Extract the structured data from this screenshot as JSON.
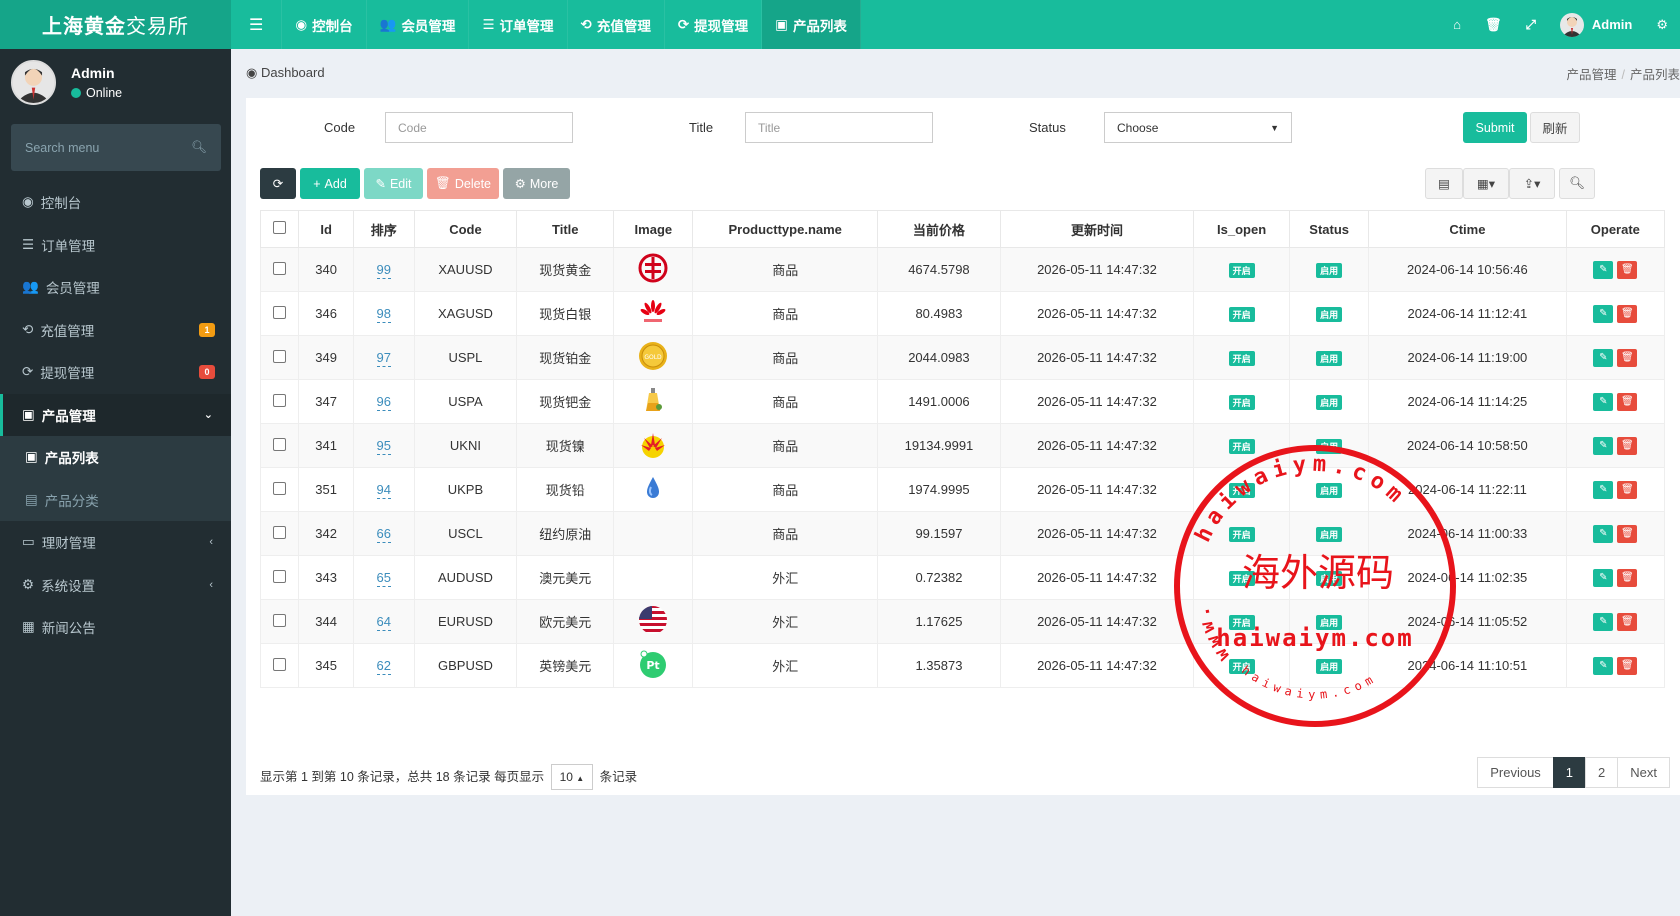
{
  "app": {
    "title_bold": "上海黄金",
    "title_rest": "交易所"
  },
  "topnav": [
    {
      "label": "控制台",
      "icon": "dashboard-icon"
    },
    {
      "label": "会员管理",
      "icon": "users-icon"
    },
    {
      "label": "订单管理",
      "icon": "list-icon"
    },
    {
      "label": "充值管理",
      "icon": "deposit-icon"
    },
    {
      "label": "提现管理",
      "icon": "withdraw-icon"
    },
    {
      "label": "产品列表",
      "icon": "shopping-bag-icon",
      "active": true
    }
  ],
  "topright": {
    "user": "Admin"
  },
  "sidebar": {
    "user": "Admin",
    "status": "Online",
    "search_placeholder": "Search menu",
    "items": [
      {
        "label": "控制台",
        "icon": "dashboard-icon"
      },
      {
        "label": "订单管理",
        "icon": "list-icon"
      },
      {
        "label": "会员管理",
        "icon": "users-icon"
      },
      {
        "label": "充值管理",
        "icon": "deposit-icon",
        "badge": "1",
        "badge_color": "#f39c12"
      },
      {
        "label": "提现管理",
        "icon": "withdraw-icon",
        "badge": "0",
        "badge_color": "#e74c3c"
      },
      {
        "label": "产品管理",
        "icon": "shopping-bag-icon",
        "open": true
      },
      {
        "label": "产品列表",
        "sub": true,
        "current": true
      },
      {
        "label": "产品分类",
        "sub": true
      },
      {
        "label": "理财管理",
        "icon": "finance-icon",
        "collapsible": true
      },
      {
        "label": "系统设置",
        "icon": "settings-icon",
        "collapsible": true
      },
      {
        "label": "新闻公告",
        "icon": "news-icon"
      }
    ]
  },
  "breadcrumb": {
    "left": "Dashboard",
    "right": [
      "产品管理",
      "产品列表"
    ]
  },
  "filters": {
    "code_label": "Code",
    "code_placeholder": "Code",
    "title_label": "Title",
    "title_placeholder": "Title",
    "status_label": "Status",
    "status_value": "Choose",
    "submit": "Submit",
    "reset": "刷新"
  },
  "toolbar": {
    "add": "Add",
    "edit": "Edit",
    "delete": "Delete",
    "more": "More"
  },
  "columns": [
    "Id",
    "排序",
    "Code",
    "Title",
    "Image",
    "Producttype.name",
    "当前价格",
    "更新时间",
    "Is_open",
    "Status",
    "Ctime",
    "Operate"
  ],
  "rows": [
    {
      "id": "340",
      "sort": "99",
      "code": "XAUUSD",
      "title": "现货黄金",
      "image": "icbc-logo",
      "type": "商品",
      "price": "4674.5798",
      "utime": "2026-05-11 14:47:32",
      "is_open": "开启",
      "status": "启用",
      "ctime": "2024-06-14 10:56:46"
    },
    {
      "id": "346",
      "sort": "98",
      "code": "XAGUSD",
      "title": "现货白银",
      "image": "huawei-logo",
      "type": "商品",
      "price": "80.4983",
      "utime": "2026-05-11 14:47:32",
      "is_open": "开启",
      "status": "启用",
      "ctime": "2024-06-14 11:12:41"
    },
    {
      "id": "349",
      "sort": "97",
      "code": "USPL",
      "title": "现货铂金",
      "image": "gold-coin",
      "type": "商品",
      "price": "2044.0983",
      "utime": "2026-05-11 14:47:32",
      "is_open": "开启",
      "status": "启用",
      "ctime": "2024-06-14 11:19:00"
    },
    {
      "id": "347",
      "sort": "96",
      "code": "USPA",
      "title": "现货钯金",
      "image": "oil-bottle",
      "type": "商品",
      "price": "1491.0006",
      "utime": "2026-05-11 14:47:32",
      "is_open": "开启",
      "status": "启用",
      "ctime": "2024-06-14 11:14:25"
    },
    {
      "id": "341",
      "sort": "95",
      "code": "UKNI",
      "title": "现货镍",
      "image": "petrochina-logo",
      "type": "商品",
      "price": "19134.9991",
      "utime": "2026-05-11 14:47:32",
      "is_open": "开启",
      "status": "启用",
      "ctime": "2024-06-14 10:58:50"
    },
    {
      "id": "351",
      "sort": "94",
      "code": "UKPB",
      "title": "现货铅",
      "image": "water-drop",
      "type": "商品",
      "price": "1974.9995",
      "utime": "2026-05-11 14:47:32",
      "is_open": "开启",
      "status": "启用",
      "ctime": "2024-06-14 11:22:11"
    },
    {
      "id": "342",
      "sort": "66",
      "code": "USCL",
      "title": "纽约原油",
      "image": "",
      "type": "商品",
      "price": "99.1597",
      "utime": "2026-05-11 14:47:32",
      "is_open": "开启",
      "status": "启用",
      "ctime": "2024-06-14 11:00:33"
    },
    {
      "id": "343",
      "sort": "65",
      "code": "AUDUSD",
      "title": "澳元美元",
      "image": "",
      "type": "外汇",
      "price": "0.72382",
      "utime": "2026-05-11 14:47:32",
      "is_open": "开启",
      "status": "启用",
      "ctime": "2024-06-14 11:02:35"
    },
    {
      "id": "344",
      "sort": "64",
      "code": "EURUSD",
      "title": "欧元美元",
      "image": "us-flag",
      "type": "外汇",
      "price": "1.17625",
      "utime": "2026-05-11 14:47:32",
      "is_open": "开启",
      "status": "启用",
      "ctime": "2024-06-14 11:05:52"
    },
    {
      "id": "345",
      "sort": "62",
      "code": "GBPUSD",
      "title": "英镑美元",
      "image": "pt-badge",
      "type": "外汇",
      "price": "1.35873",
      "utime": "2026-05-11 14:47:32",
      "is_open": "开启",
      "status": "启用",
      "ctime": "2024-06-14 11:10:51"
    }
  ],
  "pagination": {
    "info_pre": "显示第 1 到第 10 条记录，总共 18 条记录 每页显示",
    "page_size": "10",
    "info_post": "条记录",
    "prev": "Previous",
    "pages": [
      "1",
      "2"
    ],
    "next": "Next"
  },
  "watermark": {
    "top_text": "haiwaiym.com",
    "center_text": "海外源码",
    "domain": "haiwaiym.com",
    "left_text": "www."
  },
  "colors": {
    "primary": "#18bc9c",
    "sidebar": "#222d32",
    "danger": "#e74c3c",
    "warning": "#f39c12",
    "dark": "#2c3b41"
  }
}
